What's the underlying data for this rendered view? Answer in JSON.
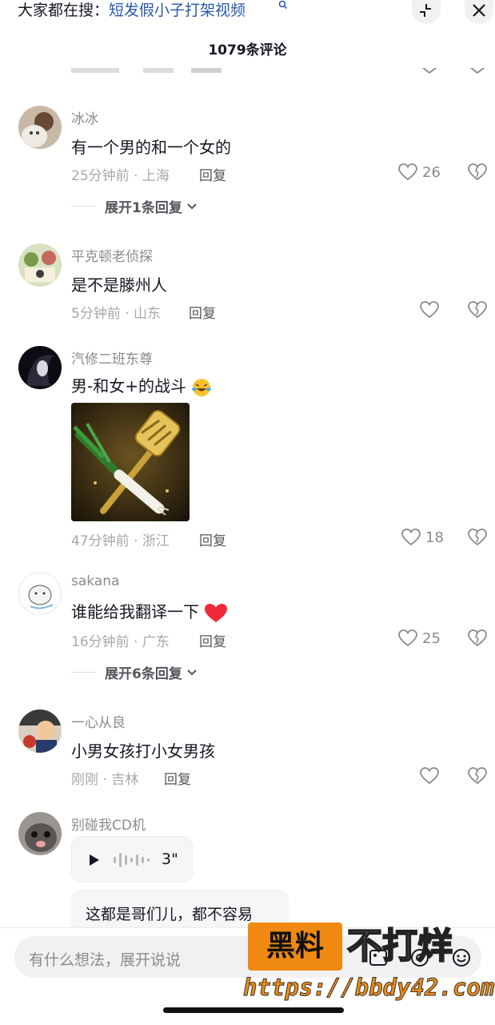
{
  "search_bar": {
    "prefix": "大家都在搜：",
    "query": "短发假小子打架视频"
  },
  "header": {
    "comment_count_label": "1079条评论"
  },
  "comments": [
    {
      "nickname": "冰冰",
      "text": "有一个男的和一个女的",
      "time": "25分钟前",
      "location": "上海",
      "reply_label": "回复",
      "likes": "26",
      "expand_label": "展开1条回复"
    },
    {
      "nickname": "平克顿老侦探",
      "text": "是不是滕州人",
      "time": "5分钟前",
      "location": "山东",
      "reply_label": "回复",
      "likes": ""
    },
    {
      "nickname": "汽修二班东尊",
      "text": "男-和女+的战斗",
      "time": "47分钟前",
      "location": "浙江",
      "reply_label": "回复",
      "likes": "18"
    },
    {
      "nickname": "sakana",
      "text": "谁能给我翻译一下",
      "time": "16分钟前",
      "location": "广东",
      "reply_label": "回复",
      "likes": "25",
      "expand_label": "展开6条回复"
    },
    {
      "nickname": "一心从良",
      "text": "小男女孩打小女男孩",
      "time": "刚刚",
      "location": "吉林",
      "reply_label": "回复",
      "likes": ""
    },
    {
      "nickname": "别碰我CD机",
      "voice_duration": "3\"",
      "bubble_text": "这都是哥们儿，都不容易"
    }
  ],
  "input_bar": {
    "placeholder": "有什么想法，展开说说"
  },
  "watermark": {
    "box_text": "黑料",
    "right_text": "不打烊",
    "url": "https://bbdy42.com"
  },
  "colors": {
    "link_blue": "#2a58a8",
    "meta_gray": "#a7a8ad",
    "watermark_orange": "#f08a12"
  }
}
